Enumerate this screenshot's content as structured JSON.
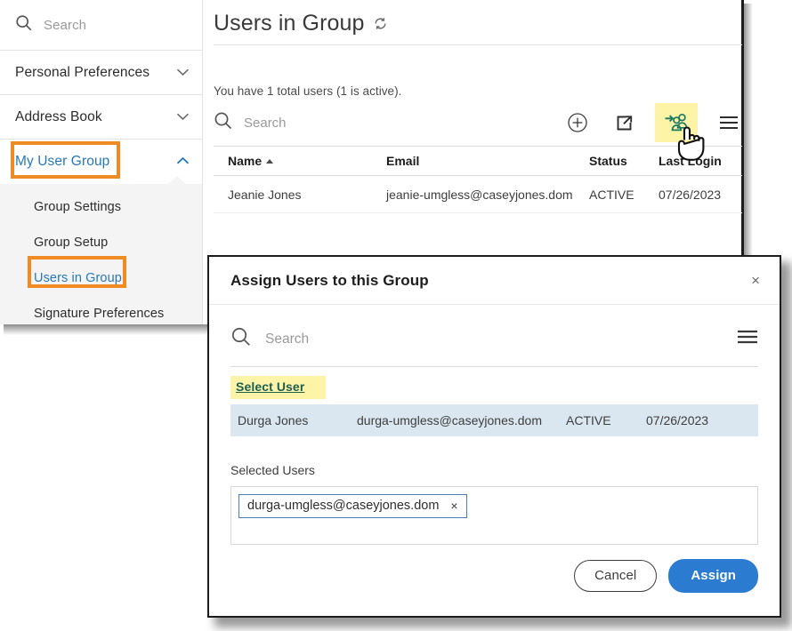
{
  "sidebar": {
    "search_placeholder": "Search",
    "sections": [
      {
        "label": "Personal Preferences",
        "state": "collapsed"
      },
      {
        "label": "Address Book",
        "state": "collapsed"
      },
      {
        "label": "My User Group",
        "state": "expanded"
      }
    ],
    "submenu": [
      {
        "label": "Group Settings"
      },
      {
        "label": "Group Setup"
      },
      {
        "label": "Users in Group"
      },
      {
        "label": "Signature Preferences"
      }
    ],
    "highlight_color": "#ef8b22"
  },
  "main": {
    "page_title": "Users in Group",
    "refresh_icon": "refresh-icon",
    "count_text": "You have 1 total users (1 is active).",
    "search_placeholder": "Search",
    "toolbar_icons": [
      {
        "name": "add-user-icon",
        "glyph": "plus-circle"
      },
      {
        "name": "export-icon",
        "glyph": "share-box"
      },
      {
        "name": "assign-users-icon",
        "glyph": "users-plus",
        "highlighted": true,
        "color": "#1c7a63"
      },
      {
        "name": "menu-icon",
        "glyph": "hamburger"
      }
    ],
    "table": {
      "columns": [
        "Name",
        "Email",
        "Status",
        "Last Login"
      ],
      "sort_column": "Name",
      "sort_direction": "asc",
      "rows": [
        {
          "name": "Jeanie Jones",
          "email": "jeanie-umgless@caseyjones.dom",
          "status": "ACTIVE",
          "last_login": "07/26/2023"
        }
      ]
    }
  },
  "dialog": {
    "title": "Assign Users to this Group",
    "close_label": "×",
    "search_placeholder": "Search",
    "menu_icon": "hamburger-icon",
    "select_user_link": "Select User",
    "select_user_highlight": "#fdf4a8",
    "results": [
      {
        "name": "Durga Jones",
        "email": "durga-umgless@caseyjones.dom",
        "status": "ACTIVE",
        "last_login": "07/26/2023",
        "selected": true
      }
    ],
    "selected_users_label": "Selected Users",
    "chips": [
      {
        "label": "durga-umgless@caseyjones.dom",
        "remove_label": "×"
      }
    ],
    "cancel_label": "Cancel",
    "assign_label": "Assign",
    "assign_color": "#2b7cd0"
  },
  "cursor": {
    "type": "pointing-hand"
  }
}
